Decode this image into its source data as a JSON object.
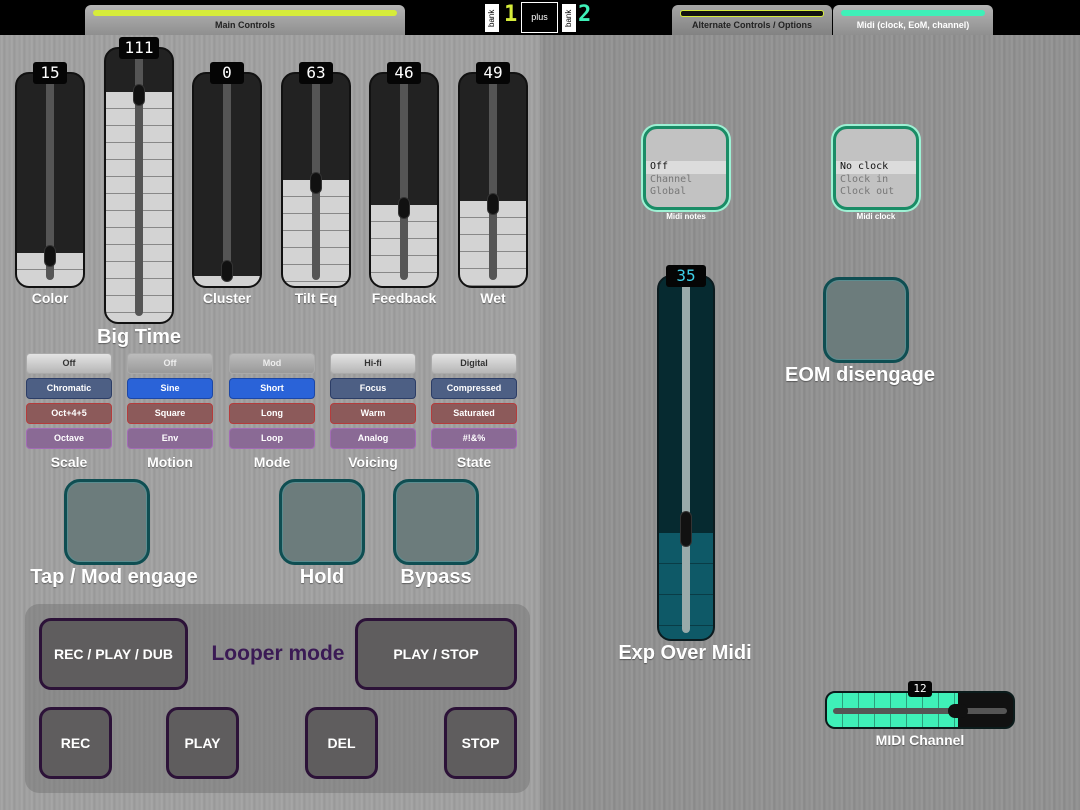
{
  "topbar": {
    "tab_main": "Main Controls",
    "bank_label": "bank",
    "bank_left_value": "1",
    "plus_label": "plus",
    "bank_right_value": "2",
    "tab_alternate": "Alternate Controls / Options",
    "tab_midi": "Midi (clock, EoM, channel)"
  },
  "faders": [
    {
      "label": "Color",
      "display": "15",
      "level": 0.12
    },
    {
      "label": "Big Time",
      "display": "111",
      "level": 0.87
    },
    {
      "label": "Cluster",
      "display": "0",
      "level": 0.0
    },
    {
      "label": "Tilt Eq",
      "display": "63",
      "level": 0.5
    },
    {
      "label": "Feedback",
      "display": "46",
      "level": 0.37
    },
    {
      "label": "Wet",
      "display": "49",
      "level": 0.39
    }
  ],
  "selectors": [
    {
      "label": "Scale",
      "options": [
        "Off",
        "Chromatic",
        "Oct+4+5",
        "Octave"
      ],
      "selected": 0
    },
    {
      "label": "Motion",
      "options": [
        "Off",
        "Sine",
        "Square",
        "Env"
      ],
      "selected": 1
    },
    {
      "label": "Mode",
      "options": [
        "Mod",
        "Short",
        "Long",
        "Loop"
      ],
      "selected": 1
    },
    {
      "label": "Voicing",
      "options": [
        "Hi-fi",
        "Focus",
        "Warm",
        "Analog"
      ],
      "selected": 0
    },
    {
      "label": "State",
      "options": [
        "Digital",
        "Compressed",
        "Saturated",
        "#!&%"
      ],
      "selected": 0
    }
  ],
  "pads": {
    "tap": "Tap / Mod engage",
    "hold": "Hold",
    "bypass": "Bypass"
  },
  "looper": {
    "title": "Looper mode",
    "rec_play_dub": "REC / PLAY / DUB",
    "play_stop": "PLAY / STOP",
    "rec": "REC",
    "play": "PLAY",
    "del": "DEL",
    "stop": "STOP"
  },
  "midi": {
    "notes_options": [
      "Off",
      "Channel",
      "Global"
    ],
    "notes_label": "Midi notes",
    "clock_options": [
      "No clock",
      "Clock in",
      "Clock out"
    ],
    "clock_label": "Midi clock",
    "eom_label": "EOM disengage",
    "exp_label": "Exp Over Midi",
    "exp_display": "35",
    "exp_level": 0.28,
    "channel_label": "MIDI Channel",
    "channel_display": "12",
    "channel_level": 0.72
  },
  "colors": {
    "accent_yellow": "#d6ec3a",
    "accent_green": "#3ff0b8",
    "pad_border": "#0f4e52"
  }
}
